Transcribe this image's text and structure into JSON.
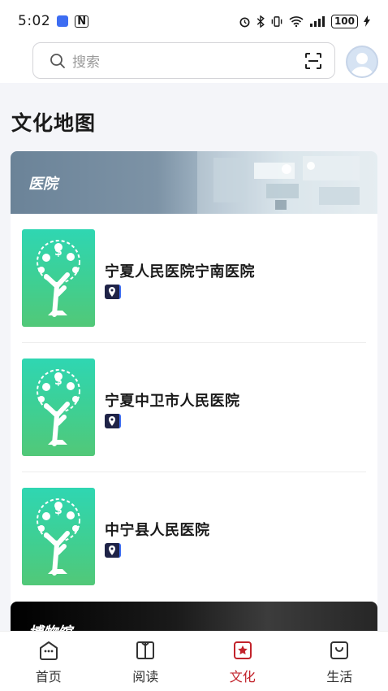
{
  "status_bar": {
    "time": "5:02",
    "battery": "100"
  },
  "search": {
    "placeholder": "搜索"
  },
  "page": {
    "title": "文化地图"
  },
  "sections": [
    {
      "label": "医院",
      "items": [
        {
          "name": "宁夏人民医院宁南医院"
        },
        {
          "name": "宁夏中卫市人民医院"
        },
        {
          "name": "中宁县人民医院"
        }
      ]
    },
    {
      "label": "博物馆"
    }
  ],
  "tabs": [
    {
      "label": "首页",
      "icon": "home-icon"
    },
    {
      "label": "阅读",
      "icon": "book-icon"
    },
    {
      "label": "文化",
      "icon": "culture-star-icon",
      "active": true
    },
    {
      "label": "生活",
      "icon": "life-bag-icon"
    }
  ],
  "colors": {
    "accent": "#c2232b",
    "thumb_green": "#3fcf92",
    "banner_blue_gray": "#6b8398"
  }
}
